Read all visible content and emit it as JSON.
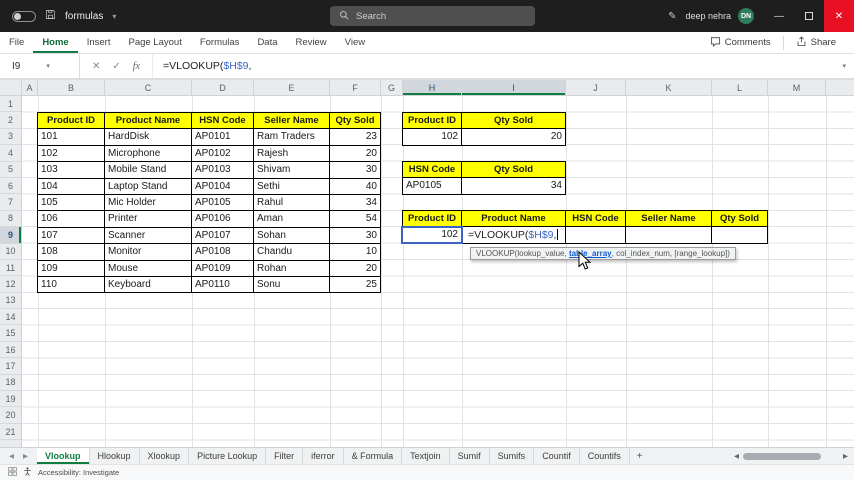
{
  "titlebar": {
    "filename": "formulas",
    "search_placeholder": "Search",
    "user_name": "deep nehra",
    "user_initials": "DN"
  },
  "ribbon": {
    "tabs": [
      "File",
      "Home",
      "Insert",
      "Page Layout",
      "Formulas",
      "Data",
      "Review",
      "View"
    ],
    "active_tab": "Home",
    "comments_label": "Comments",
    "share_label": "Share"
  },
  "formula_bar": {
    "name_box": "I9",
    "cancel_glyph": "✕",
    "enter_glyph": "✓",
    "fx_label": "fx",
    "formula_prefix": "=VLOOKUP(",
    "formula_ref": "$H$9",
    "formula_comma": ","
  },
  "grid": {
    "selected_cell": "I9",
    "columns": [
      "A",
      "B",
      "C",
      "D",
      "E",
      "F",
      "G",
      "H",
      "I",
      "J",
      "K",
      "L",
      "M"
    ],
    "rows": [
      "1",
      "2",
      "3",
      "4",
      "5",
      "6",
      "7",
      "8",
      "9",
      "10",
      "11",
      "12",
      "13",
      "14",
      "15",
      "16",
      "17",
      "18",
      "19",
      "20",
      "21"
    ]
  },
  "product_table": {
    "headers": [
      "Product ID",
      "Product Name",
      "HSN Code",
      "Seller Name",
      "Qty Sold"
    ],
    "rows": [
      [
        "101",
        "HardDisk",
        "AP0101",
        "Ram Traders",
        "23"
      ],
      [
        "102",
        "Microphone",
        "AP0102",
        "Rajesh",
        "20"
      ],
      [
        "103",
        "Mobile Stand",
        "AP0103",
        "Shivam",
        "30"
      ],
      [
        "104",
        "Laptop Stand",
        "AP0104",
        "Sethi",
        "40"
      ],
      [
        "105",
        "Mic Holder",
        "AP0105",
        "Rahul",
        "34"
      ],
      [
        "106",
        "Printer",
        "AP0106",
        "Aman",
        "54"
      ],
      [
        "107",
        "Scanner",
        "AP0107",
        "Sohan",
        "30"
      ],
      [
        "108",
        "Monitor",
        "AP0108",
        "Chandu",
        "10"
      ],
      [
        "109",
        "Mouse",
        "AP0109",
        "Rohan",
        "20"
      ],
      [
        "110",
        "Keyboard",
        "AP0110",
        "Sonu",
        "25"
      ]
    ]
  },
  "lookup_table_1": {
    "headers": [
      "Product ID",
      "Qty Sold"
    ],
    "row": [
      "102",
      "20"
    ]
  },
  "lookup_table_2": {
    "headers": [
      "HSN Code",
      "Qty Sold"
    ],
    "row": [
      "AP0105",
      "34"
    ]
  },
  "result_table": {
    "headers": [
      "Product ID",
      "Product Name",
      "HSN Code",
      "Seller Name",
      "Qty Sold"
    ],
    "product_id": "102",
    "editing_formula_prefix": "=VLOOKUP(",
    "editing_formula_ref": "$H$9",
    "editing_formula_comma": ","
  },
  "tooltip": {
    "pre": "VLOOKUP(lookup_value, ",
    "current_arg": "table_array",
    "post": ", col_index_num, [range_lookup])"
  },
  "sheet_tabs": {
    "active": "Vlookup",
    "tabs": [
      "Vlookup",
      "Hlookup",
      "Xlookup",
      "Picture Lookup",
      "Filter",
      "iferror",
      "& Formula",
      "Textjoin",
      "Sumif",
      "Sumifs",
      "Countif",
      "Countifs"
    ]
  },
  "status_bar": {
    "accessibility_label": "Accessibility: Investigate"
  },
  "colors": {
    "header_fill": "#ffff00",
    "titlebar_bg": "#1e1e1e",
    "close_button": "#e81123",
    "excel_green": "#107c41",
    "reference_blue": "#3c64c4"
  }
}
